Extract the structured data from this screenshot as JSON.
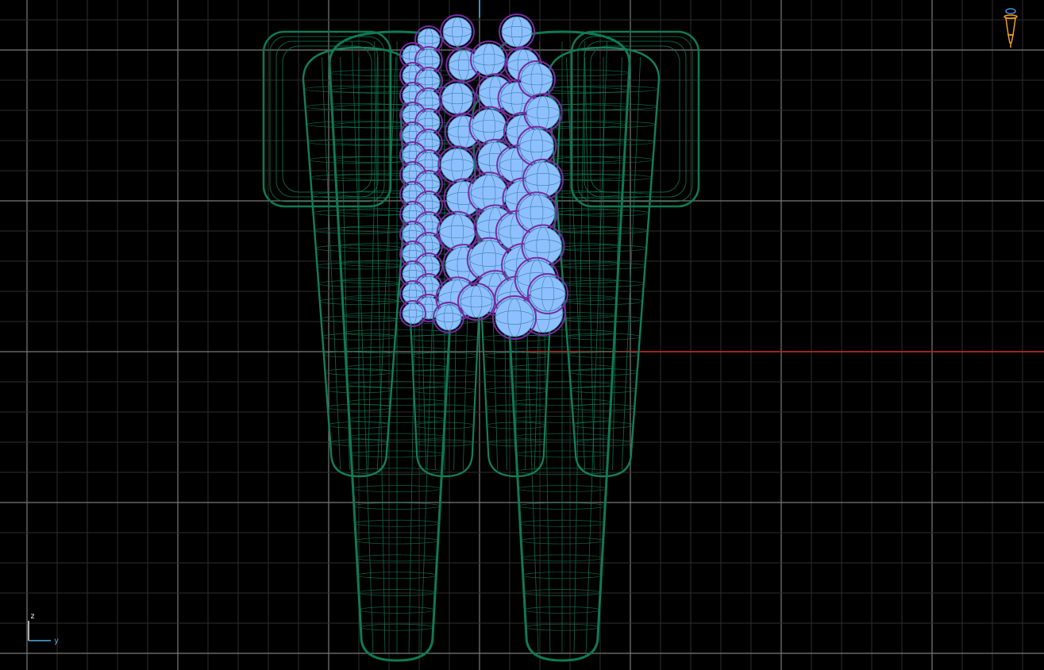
{
  "viewport": {
    "background": "#000000",
    "grid_minor_color": "#2e2e2e",
    "grid_major_color": "#7a7a7a",
    "axis_x_color": "#c0281c",
    "axis_z_color": "#3fb4e6"
  },
  "orientation_indicator": {
    "up_label": "z",
    "right_label": "y",
    "up_color": "#e8e8e8",
    "right_color": "#4fb0e0"
  },
  "view_gizmo": {
    "icon": "camera-view-icon",
    "color": "#f0a020",
    "accent_color": "#4a90e2"
  },
  "scene": {
    "outer_shell_color": "#0f7a52",
    "inner_shell_color": "#127f58",
    "sphere_outline_color": "#7a2aa0",
    "sphere_fill_color": "#8ec0ff",
    "sphere_wire_color": "#3a7fa8"
  }
}
